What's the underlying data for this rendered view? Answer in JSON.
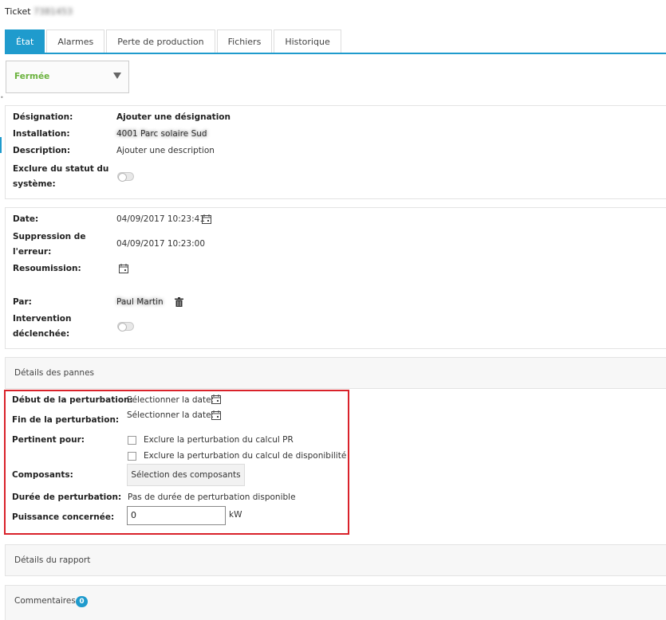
{
  "ticket": {
    "title": "Ticket",
    "id": "7381453"
  },
  "tabs": [
    {
      "label": "État"
    },
    {
      "label": "Alarmes"
    },
    {
      "label": "Perte de production"
    },
    {
      "label": "Fichiers"
    },
    {
      "label": "Historique"
    }
  ],
  "status": {
    "value": "Fermée"
  },
  "general": {
    "designation_label": "Désignation:",
    "designation_value": "Ajouter une désignation",
    "installation_label": "Installation:",
    "installation_value": "4001 Parc solaire Sud",
    "description_label": "Description:",
    "description_value": "Ajouter une description",
    "exclude_label_1": "Exclure du statut du",
    "exclude_label_2": "système:"
  },
  "dates": {
    "date_label": "Date:",
    "date_value": "04/09/2017 10:23:41",
    "suppression_label_1": "Suppression de",
    "suppression_label_2": "l'erreur:",
    "suppression_value": "04/09/2017 10:23:00",
    "resoumission_label": "Resoumission:",
    "par_label": "Par:",
    "par_value": "Paul Martin",
    "intervention_label_1": "Intervention",
    "intervention_label_2": "déclenchée:"
  },
  "details_pannes": {
    "header": "Détails des pannes",
    "debut_label": "Début de la perturbation:",
    "debut_value": "Sélectionner la date:",
    "fin_label": "Fin de la perturbation:",
    "fin_value": "Sélectionner la date:",
    "pertinent_label": "Pertinent pour:",
    "check_pr": "Exclure la perturbation du calcul PR",
    "check_dispo": "Exclure la perturbation du calcul de disponibilité",
    "composants_label": "Composants:",
    "composants_button": "Sélection des composants",
    "duree_label": "Durée de perturbation:",
    "duree_value": "Pas de durée de perturbation disponible",
    "puissance_label": "Puissance concernée:",
    "puissance_value": "0",
    "puissance_unit": "kW"
  },
  "details_rapport": {
    "header": "Détails du rapport"
  },
  "commentaires": {
    "header": "Commentaires",
    "count": "0"
  },
  "colors": {
    "accent": "#1f9bcd",
    "status_green": "#6cb33f",
    "highlight_red": "#d9222a"
  }
}
